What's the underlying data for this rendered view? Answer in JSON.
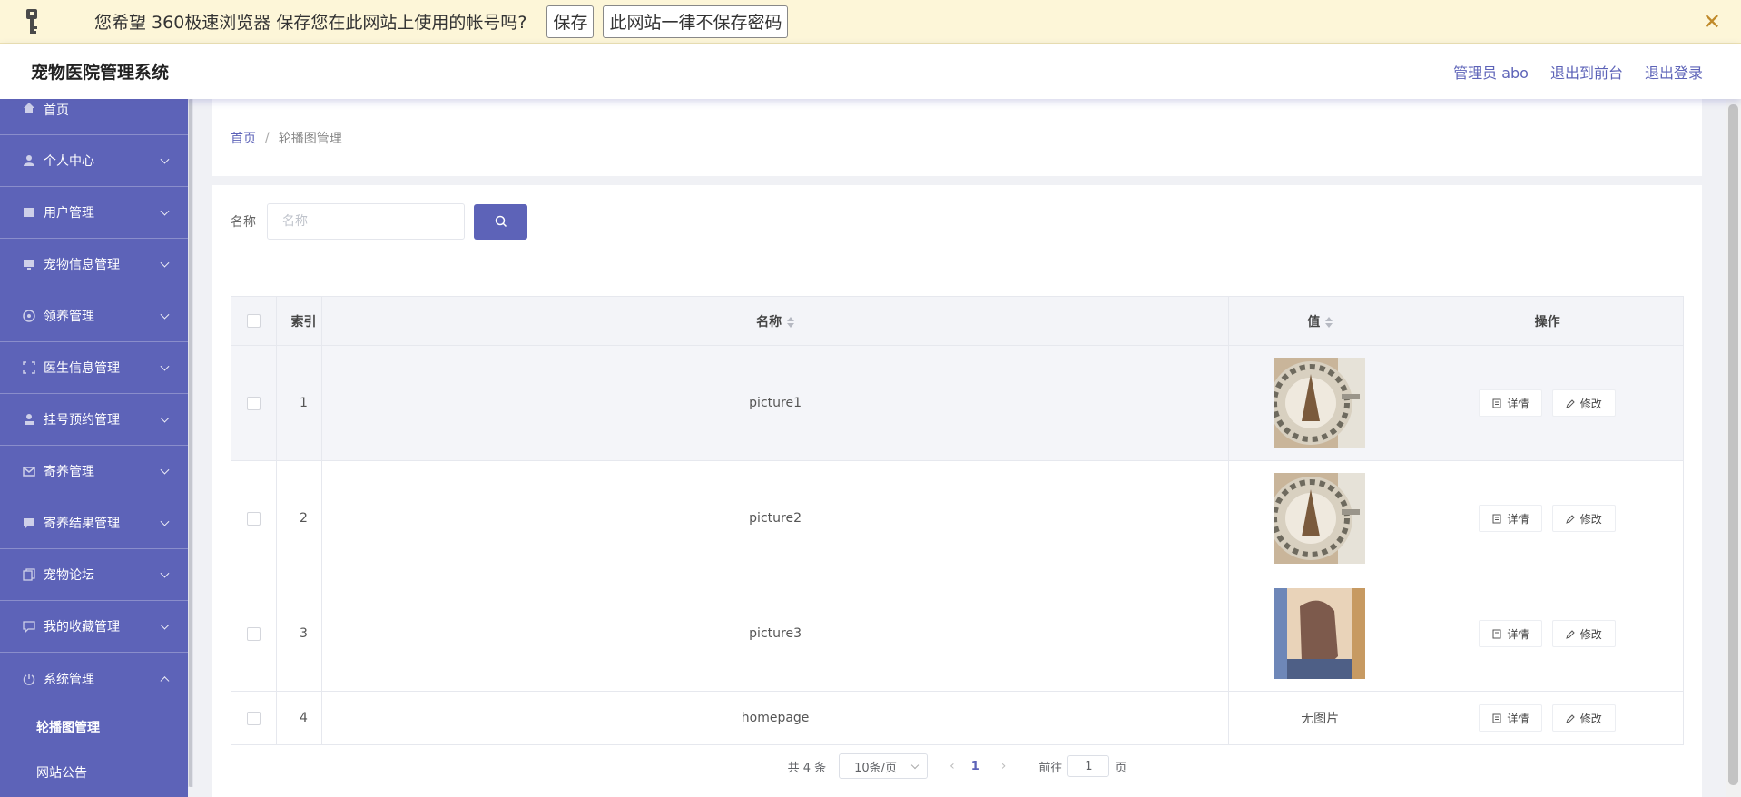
{
  "password_bar": {
    "message": "您希望 360极速浏览器 保存您在此网站上使用的帐号吗?",
    "save_label": "保存",
    "never_label": "此网站一律不保存密码",
    "close_glyph": "✕"
  },
  "header": {
    "brand": "宠物医院管理系统",
    "user": "管理员 abo",
    "to_front": "退出到前台",
    "logout": "退出登录"
  },
  "sidebar": {
    "items": [
      {
        "label": "首页",
        "icon": "home-icon"
      },
      {
        "label": "个人中心",
        "icon": "user-icon"
      },
      {
        "label": "用户管理",
        "icon": "users-icon"
      },
      {
        "label": "宠物信息管理",
        "icon": "monitor-icon"
      },
      {
        "label": "领养管理",
        "icon": "aperture-icon"
      },
      {
        "label": "医生信息管理",
        "icon": "fullscreen-icon"
      },
      {
        "label": "挂号预约管理",
        "icon": "person-icon"
      },
      {
        "label": "寄养管理",
        "icon": "mail-icon"
      },
      {
        "label": "寄养结果管理",
        "icon": "chat-icon"
      },
      {
        "label": "宠物论坛",
        "icon": "copy-icon"
      },
      {
        "label": "我的收藏管理",
        "icon": "message-icon"
      },
      {
        "label": "系统管理",
        "icon": "power-icon"
      }
    ],
    "sub_items": [
      {
        "label": "轮播图管理"
      },
      {
        "label": "网站公告"
      }
    ]
  },
  "breadcrumb": {
    "home": "首页",
    "separator": "/",
    "current": "轮播图管理"
  },
  "search": {
    "label": "名称",
    "placeholder": "名称"
  },
  "table": {
    "headers": {
      "index": "索引",
      "name": "名称",
      "value": "值",
      "ops": "操作"
    },
    "detail_label": "详情",
    "edit_label": "修改",
    "rows": [
      {
        "index": "1",
        "name": "picture1",
        "image": "clock"
      },
      {
        "index": "2",
        "name": "picture2",
        "image": "clock"
      },
      {
        "index": "3",
        "name": "picture3",
        "image": "hand"
      },
      {
        "index": "4",
        "name": "homepage",
        "no_image_text": "无图片"
      }
    ]
  },
  "pagination": {
    "total": "共 4 条",
    "page_size": "10条/页",
    "current_page": "1",
    "goto_prefix": "前往",
    "goto_value": "1",
    "goto_suffix": "页"
  },
  "colors": {
    "accent": "#5d63b8",
    "banner_bg": "#fdf6d8"
  }
}
